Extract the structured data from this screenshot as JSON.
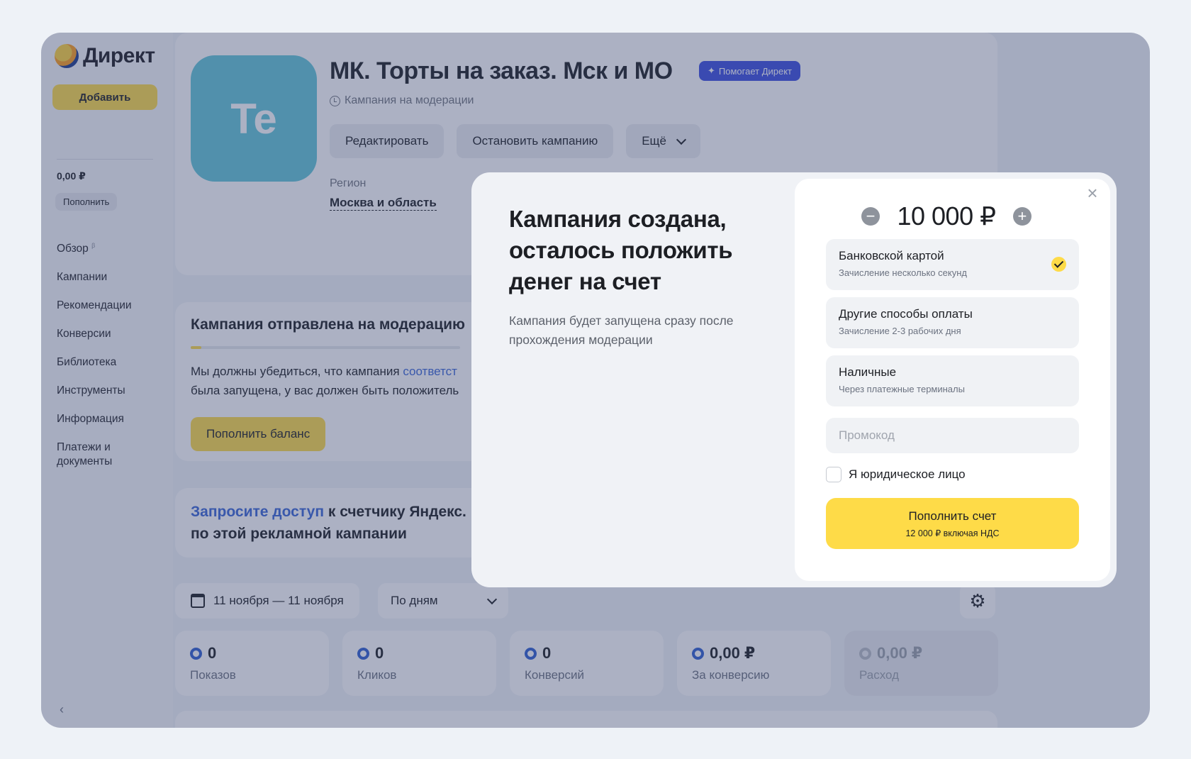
{
  "sidebar": {
    "logo": "Директ",
    "add_label": "Добавить",
    "balance": "0,00 ₽",
    "topup_label": "Пополнить",
    "nav": [
      {
        "label": "Обзор",
        "badge": "β"
      },
      {
        "label": "Кампании"
      },
      {
        "label": "Рекомендации"
      },
      {
        "label": "Конверсии"
      },
      {
        "label": "Библиотека"
      },
      {
        "label": "Инструменты"
      },
      {
        "label": "Информация"
      },
      {
        "label": "Платежи и документы"
      }
    ],
    "collapse_icon": "‹"
  },
  "campaign": {
    "avatar_text": "Te",
    "title": "МК. Торты на заказ. Мск и МО",
    "badge": "Помогает Директ",
    "status": "Кампания на модерации",
    "buttons": {
      "edit": "Редактировать",
      "stop": "Остановить кампанию",
      "more": "Ещё"
    },
    "region_label": "Регион",
    "region_value": "Москва и область"
  },
  "moderation": {
    "title": "Кампания отправлена на модерацию",
    "progress": 0.04,
    "text_1": "Мы должны убедиться, что кампания ",
    "text_link": "соответст",
    "text_2": "была запущена, у вас должен быть положитель",
    "button": "Пополнить баланс"
  },
  "access": {
    "link": "Запросите доступ",
    "text_1": " к счетчику Яндекс.",
    "text_2": "по этой рекламной кампании"
  },
  "filters": {
    "date_range": "11 ноября — 11 ноября",
    "period": "По дням"
  },
  "metrics": [
    {
      "value": "0",
      "label": "Показов"
    },
    {
      "value": "0",
      "label": "Кликов"
    },
    {
      "value": "0",
      "label": "Конверсий"
    },
    {
      "value": "0,00 ₽",
      "label": "За конверсию"
    },
    {
      "value": "0,00 ₽",
      "label": "Расход"
    }
  ],
  "modal": {
    "title": "Кампания создана, осталось положить денег на счет",
    "description": "Кампания будет запущена сразу после прохождения модерации",
    "close_icon": "×",
    "amount": "10 000 ₽",
    "minus_icon": "−",
    "plus_icon": "+",
    "payment_options": [
      {
        "title": "Банковской картой",
        "subtitle": "Зачисление несколько секунд",
        "selected": true
      },
      {
        "title": "Другие способы оплаты",
        "subtitle": "Зачисление 2-3 рабочих дня"
      },
      {
        "title": "Наличные",
        "subtitle": "Через платежные терминалы"
      }
    ],
    "promo_placeholder": "Промокод",
    "legal_label": "Я юридическое лицо",
    "submit_label": "Пополнить счет",
    "submit_sub": "12 000 ₽ включая НДС"
  },
  "colors": {
    "accent_yellow": "#fedb48",
    "link_blue": "#3a66d6",
    "badge_blue": "#3b4fe0",
    "avatar_teal": "#62c6d8",
    "overlay": "#3a4670"
  }
}
